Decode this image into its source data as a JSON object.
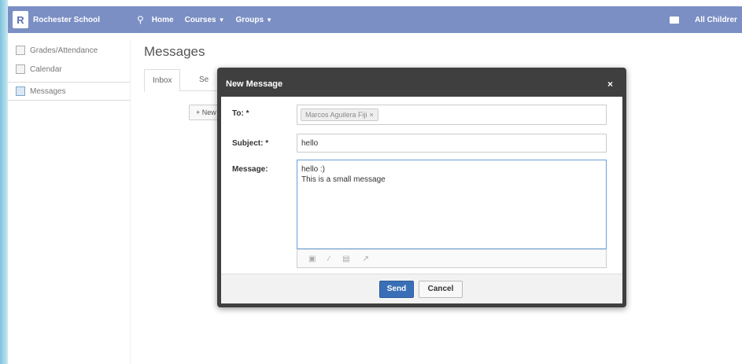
{
  "header": {
    "school_name": "Rochester School",
    "nav": [
      {
        "label": "Home"
      },
      {
        "label": "Courses"
      },
      {
        "label": "Groups"
      }
    ],
    "user_label": "All Childrer"
  },
  "sidebar": {
    "items": [
      {
        "label": "Grades/Attendance"
      },
      {
        "label": "Calendar"
      },
      {
        "label": "Messages"
      }
    ]
  },
  "main": {
    "title": "Messages",
    "tabs": [
      {
        "label": "Inbox"
      },
      {
        "label": "Se"
      }
    ],
    "new_button": "+ New"
  },
  "modal": {
    "title": "New Message",
    "close": "×",
    "to_label": "To: *",
    "to_recipient": "Marcos Aguilera Fiji",
    "subject_label": "Subject: *",
    "subject_value": "hello",
    "message_label": "Message:",
    "message_value": "hello :)\nThis is a small message",
    "send_label": "Send",
    "cancel_label": "Cancel"
  },
  "colors": {
    "topbar": "#7b8fc4",
    "modal_chrome": "#3f3f3f",
    "primary_button": "#3a6fb7"
  }
}
